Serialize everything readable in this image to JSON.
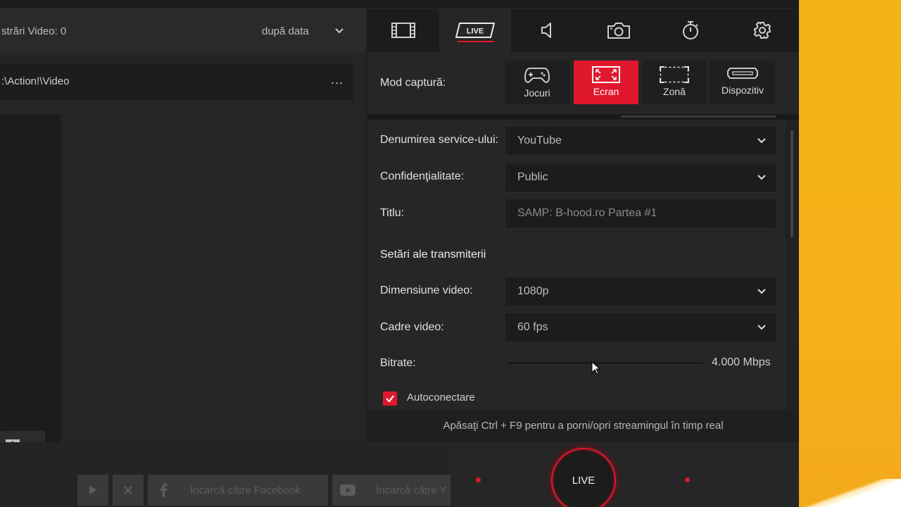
{
  "left_panel": {
    "recordings_count": "străr‌i Video: 0",
    "sort_label": "după data",
    "path": ":\\Action!\\Video",
    "more": "..."
  },
  "bottom_bar": {
    "facebook_label": "Încarcă către Facebook",
    "youtube_label": "Încarcă către Y"
  },
  "tabs": [
    "video-tab",
    "live-tab",
    "audio-tab",
    "screenshot-tab",
    "timer-tab",
    "settings-tab"
  ],
  "live_tab_label": "LIVE",
  "capture": {
    "label": "Mod captură:",
    "modes": [
      {
        "label": "Jocuri",
        "icon": "gamepad-icon"
      },
      {
        "label": "Ecran",
        "icon": "fullscreen-icon",
        "active": true
      },
      {
        "label": "Zonă",
        "icon": "area-select-icon"
      },
      {
        "label": "Dispozitiv",
        "icon": "device-icon"
      }
    ]
  },
  "settings": {
    "service_label": "Denumirea service-ului:",
    "service_value": "YouTube",
    "privacy_label": "Confidenţialitate:",
    "privacy_value": "Public",
    "title_label": "Titlu:",
    "title_placeholder": "SAMP: B-hood.ro Partea #1",
    "section_title": "Setări ale transmiterii",
    "video_size_label": "Dimensiune video:",
    "video_size_value": "1080p",
    "frames_label": "Cadre video:",
    "frames_value": "60 fps",
    "bitrate_label": "Bitrate:",
    "bitrate_value": "4.000 Mbps",
    "autoconnect_label": "Autoconectare"
  },
  "hint": "Apăsaţi Ctrl + F9 pentru a porni/opri streamingul în timp real",
  "live_button": "LIVE",
  "colors": {
    "accent": "#e0182d",
    "panel": "#262626",
    "field": "#1c1c1c",
    "desktop": "#f6b21a"
  }
}
